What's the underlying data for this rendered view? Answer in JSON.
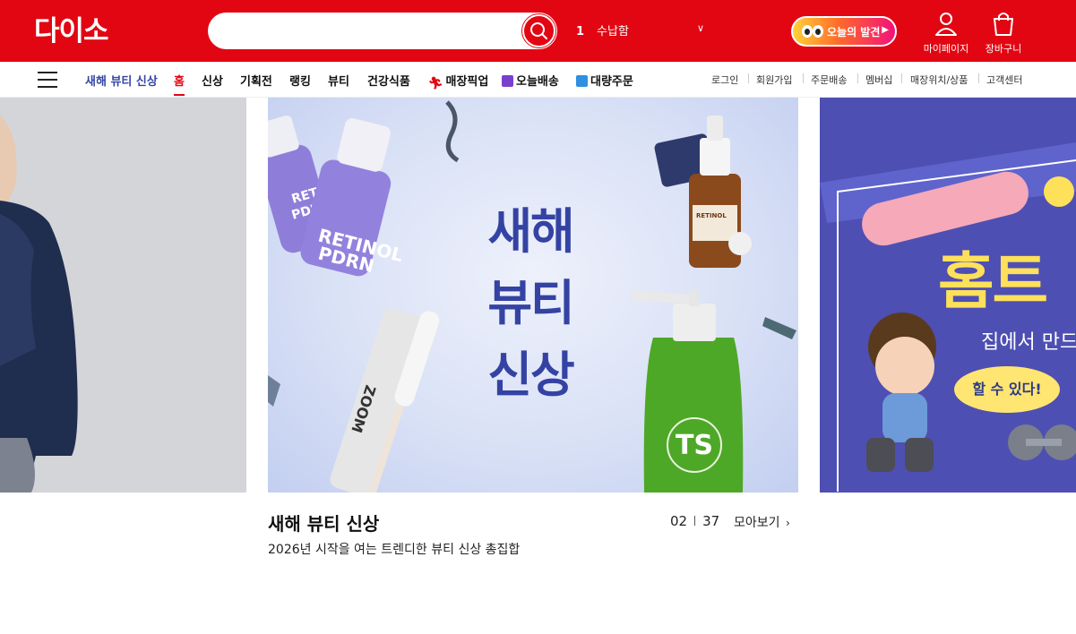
{
  "header": {
    "logo": "다이소",
    "search": {
      "placeholder": "",
      "value": ""
    },
    "trending": {
      "rank": "1",
      "keyword": "수납함"
    },
    "discover_label": "오늘의 발견",
    "mypage_label": "마이페이지",
    "cart_label": "장바구니"
  },
  "nav": {
    "items": [
      {
        "label": "새해 뷰티 신상",
        "style": "featured"
      },
      {
        "label": "홈",
        "style": "active"
      },
      {
        "label": "신상"
      },
      {
        "label": "기획전"
      },
      {
        "label": "랭킹"
      },
      {
        "label": "뷰티"
      },
      {
        "label": "건강식품"
      },
      {
        "label": "매장픽업",
        "icon": "running-person-icon"
      },
      {
        "label": "오늘배송",
        "icon": "delivery-truck-icon"
      },
      {
        "label": "대량주문",
        "icon": "box-icon"
      }
    ],
    "util": [
      "로그인",
      "회원가입",
      "주문배송",
      "멤버십",
      "매장위치/상품",
      "고객센터"
    ]
  },
  "carousel": {
    "main_headline": [
      "새해",
      "뷰티",
      "신상"
    ],
    "product_labels": {
      "retinol_bottle": "RETINOL PDRN",
      "retinol_small": "RETINOL PDR",
      "ampoule": "RETINOL",
      "zoom_tube": "ZOOM",
      "ts_bottle": "TS"
    },
    "right_slide": {
      "title": "홈트",
      "subtitle": "집에서 만드",
      "bubble": "할 수 있다!"
    },
    "caption": {
      "title": "새해 뷰티 신상",
      "description": "2026년 시작을 여는 트렌디한 뷰티 신상 총집합",
      "current": "02",
      "total": "37",
      "view_all": "모아보기"
    }
  },
  "colors": {
    "brand_red": "#e20613",
    "featured_blue": "#3445a5",
    "headline_blue": "#3443a3",
    "right_slide_bg": "#4e4fb3"
  }
}
